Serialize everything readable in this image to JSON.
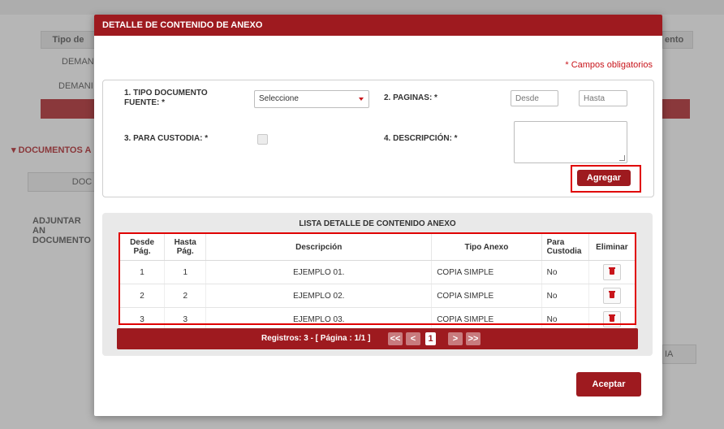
{
  "background": {
    "col_tipo": "Tipo de",
    "col_ento": "ento",
    "row1": "DEMANI",
    "row2": "DEMANI",
    "section": "DOCUMENTOS A",
    "tab": "DOC",
    "adjuntar": "ADJUNTAR AN DOCUMENTO",
    "right_btn": "IA"
  },
  "modal": {
    "title": "DETALLE DE CONTENIDO DE ANEXO",
    "required_note": "* Campos obligatorios",
    "form": {
      "tipo_label": "1. TIPO DOCUMENTO FUENTE: *",
      "tipo_value": "Seleccione",
      "paginas_label": "2. PAGINAS: *",
      "desde_placeholder": "Desde",
      "hasta_placeholder": "Hasta",
      "custodia_label": "3. PARA CUSTODIA: *",
      "descripcion_label": "4. DESCRIPCIÓN: *",
      "add_button": "Agregar"
    },
    "list": {
      "title": "LISTA DETALLE DE CONTENIDO ANEXO",
      "headers": {
        "desde": "Desde Pág.",
        "hasta": "Hasta Pág.",
        "descripcion": "Descripción",
        "tipo": "Tipo Anexo",
        "custodia": "Para Custodia",
        "eliminar": "Eliminar"
      },
      "rows": [
        {
          "desde": "1",
          "hasta": "1",
          "descripcion": "EJEMPLO 01.",
          "tipo": "COPIA SIMPLE",
          "custodia": "No"
        },
        {
          "desde": "2",
          "hasta": "2",
          "descripcion": "EJEMPLO 02.",
          "tipo": "COPIA SIMPLE",
          "custodia": "No"
        },
        {
          "desde": "3",
          "hasta": "3",
          "descripcion": "EJEMPLO 03.",
          "tipo": "COPIA SIMPLE",
          "custodia": "No"
        }
      ]
    },
    "pager": {
      "registros": "Registros: 3 - [ Página : 1/1 ]",
      "first": "<<",
      "prev": "<",
      "current": "1",
      "next": ">",
      "last": ">>"
    },
    "accept_button": "Aceptar"
  },
  "colors": {
    "brand_red": "#9e1a1f",
    "highlight_red": "#e00000",
    "required_red": "#c8141a"
  }
}
